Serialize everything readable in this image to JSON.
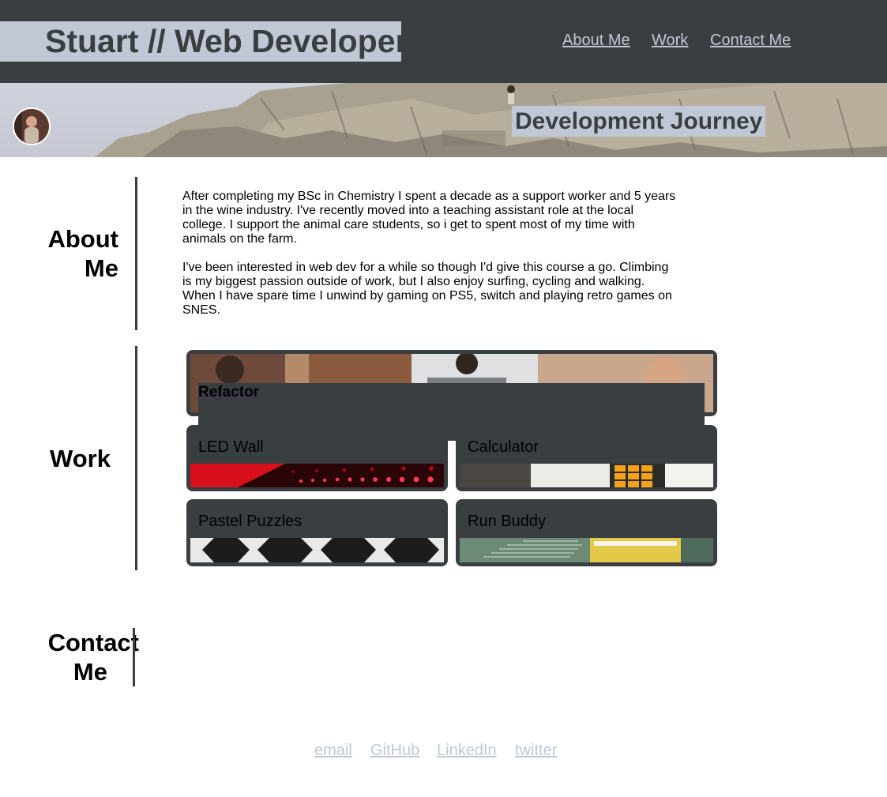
{
  "header": {
    "title": "Stuart // Web Developer",
    "nav": [
      "About Me",
      "Work",
      "Contact Me"
    ]
  },
  "hero": {
    "title": "Development Journey",
    "avatar_icon": "profile-photo"
  },
  "about": {
    "heading_line1": "About",
    "heading_line2": "Me",
    "paragraphs": [
      "After completing my BSc in Chemistry I spent a decade as a support worker and 5 years in the wine industry. I've recently moved into a teaching assistant role at the local college. I support the animal care students, so i get to spent most of my time with animals on the farm.",
      "I've been interested in web dev for a while so though I'd give this course a go. Climbing is my biggest passion outside of work, but I also enjoy surfing, cycling and walking. When I have spare time I unwind by gaming on PS5, switch and playing retro games on SNES."
    ]
  },
  "work": {
    "heading": "Work",
    "featured": "Refactor",
    "projects": [
      "LED Wall",
      "Calculator",
      "Pastel Puzzles",
      "Run Buddy"
    ]
  },
  "contact": {
    "heading_line1": "Contact",
    "heading_line2": "Me",
    "links": [
      "email",
      "GitHub",
      "LinkedIn",
      "twitter"
    ]
  },
  "colors": {
    "dark": "#393e41",
    "accent": "#c2c7d6"
  }
}
